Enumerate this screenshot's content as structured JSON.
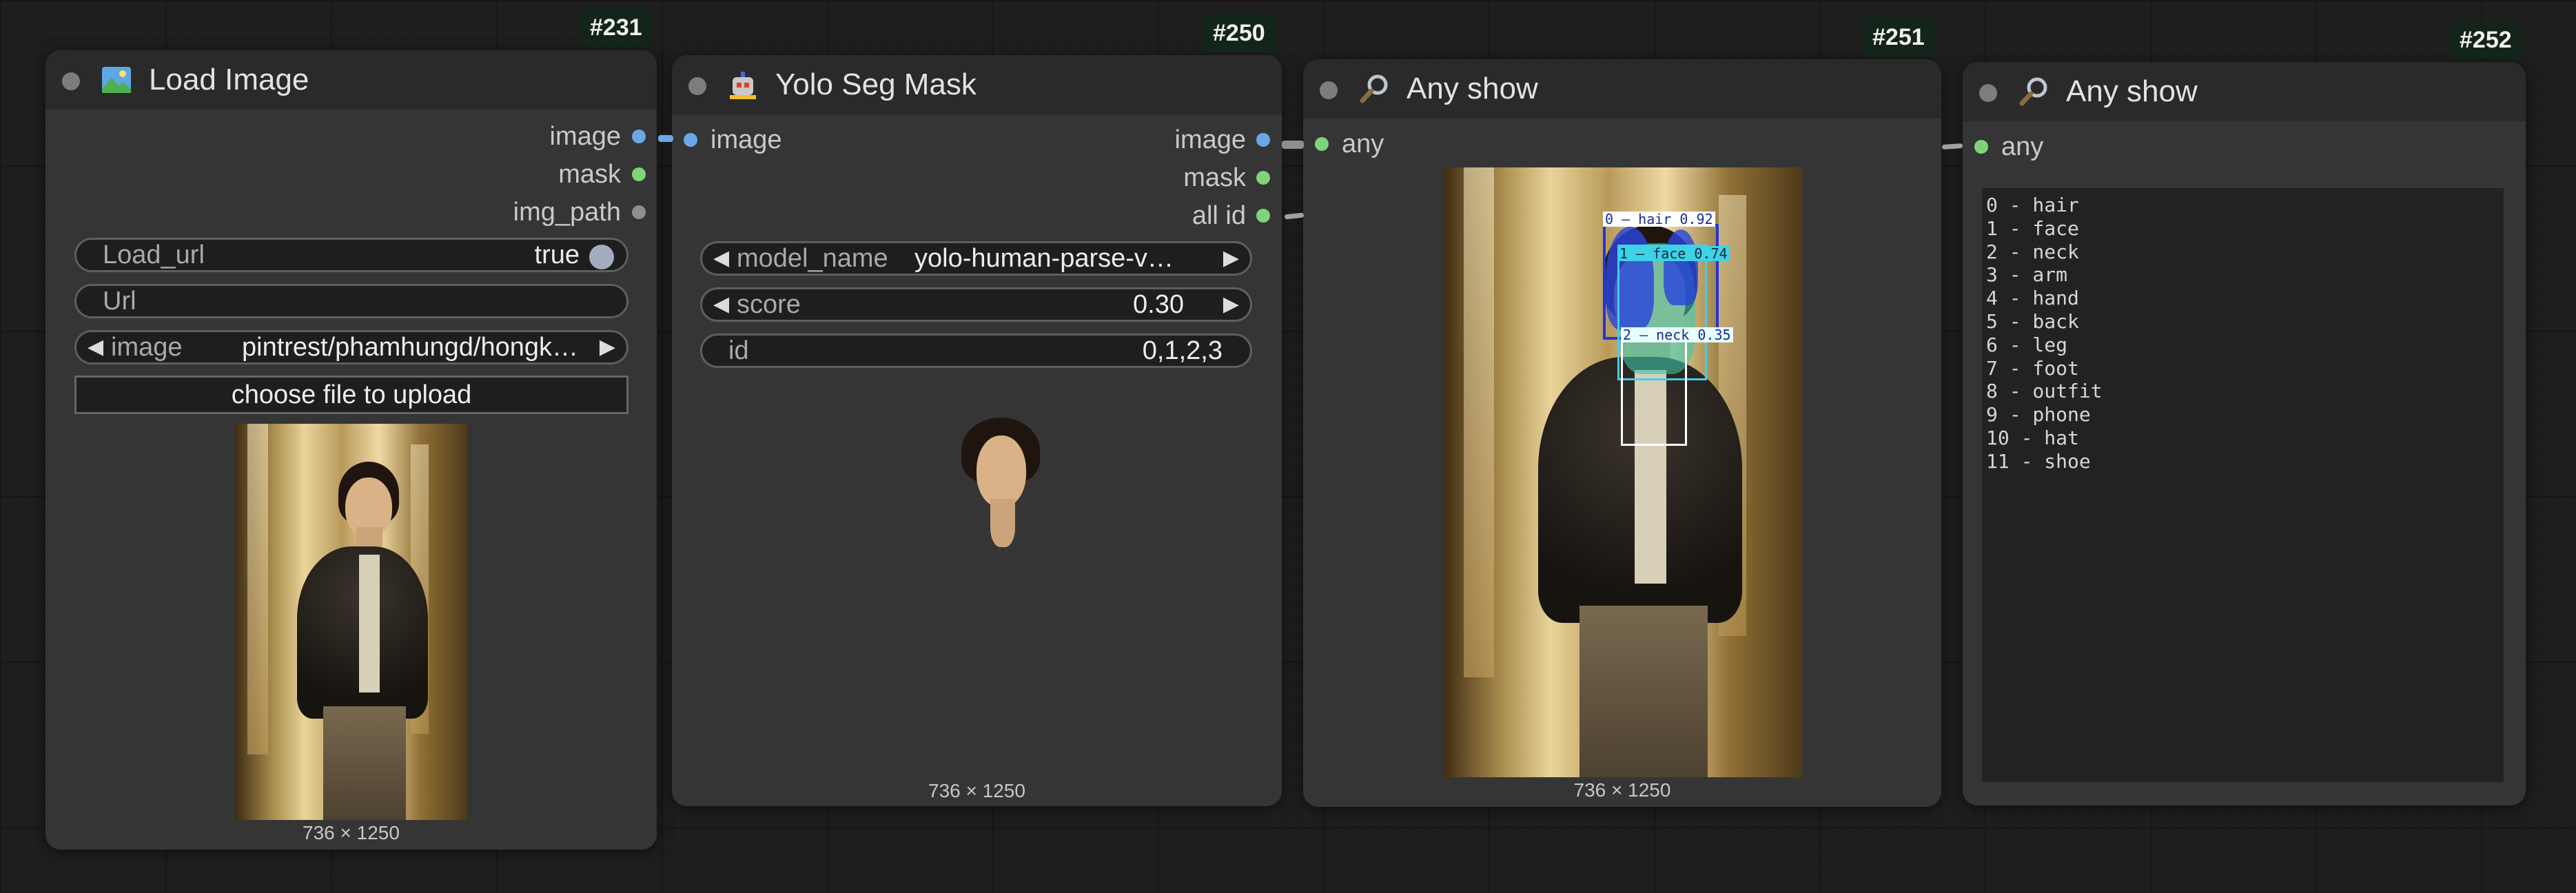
{
  "nodes": {
    "load_image": {
      "id": "#231",
      "title": "Load Image",
      "icon": "picture-icon",
      "outputs": [
        "image",
        "mask",
        "img_path"
      ],
      "widgets": {
        "load_url_label": "Load_url",
        "load_url_value": "true",
        "url_placeholder": "Url",
        "image_label": "image",
        "image_value": "pintrest/phamhungd/hongk…",
        "upload_button": "choose file to upload"
      },
      "preview_size": "736 × 1250"
    },
    "yolo_seg_mask": {
      "id": "#250",
      "title": "Yolo Seg Mask",
      "icon": "robot-icon",
      "inputs": [
        "image"
      ],
      "outputs": [
        "image",
        "mask",
        "all id"
      ],
      "widgets": {
        "model_name_label": "model_name",
        "model_name_value": "yolo-human-parse-v…",
        "score_label": "score",
        "score_value": "0.30",
        "id_label": "id",
        "id_value": "0,1,2,3"
      },
      "preview_size": "736 × 1250"
    },
    "any_show_1": {
      "id": "#251",
      "title": "Any show",
      "icon": "magnifier-icon",
      "inputs": [
        "any"
      ],
      "detections": [
        {
          "label": "0 – hair 0.92",
          "color": "#2233dd"
        },
        {
          "label": "1 – face 0.74",
          "color": "#3fd1e6"
        },
        {
          "label": "2 – neck 0.35",
          "color": "#ffffff"
        }
      ],
      "preview_size": "736 × 1250"
    },
    "any_show_2": {
      "id": "#252",
      "title": "Any show",
      "icon": "magnifier-icon",
      "inputs": [
        "any"
      ],
      "text_lines": [
        "0 - hair",
        "1 - face",
        "2 - neck",
        "3 - arm",
        "4 - hand",
        "5 - back",
        "6 - leg",
        "7 - foot",
        "8 - outfit",
        "9 - phone",
        "10 - hat",
        "11 - shoe"
      ]
    }
  },
  "colors": {
    "canvas": "#1e1e1e",
    "node_body": "#353535",
    "node_header": "#2a2a2a",
    "port_image": "#6aa7e6",
    "port_mask": "#7fd479",
    "node_id_badge": "#13251a"
  }
}
